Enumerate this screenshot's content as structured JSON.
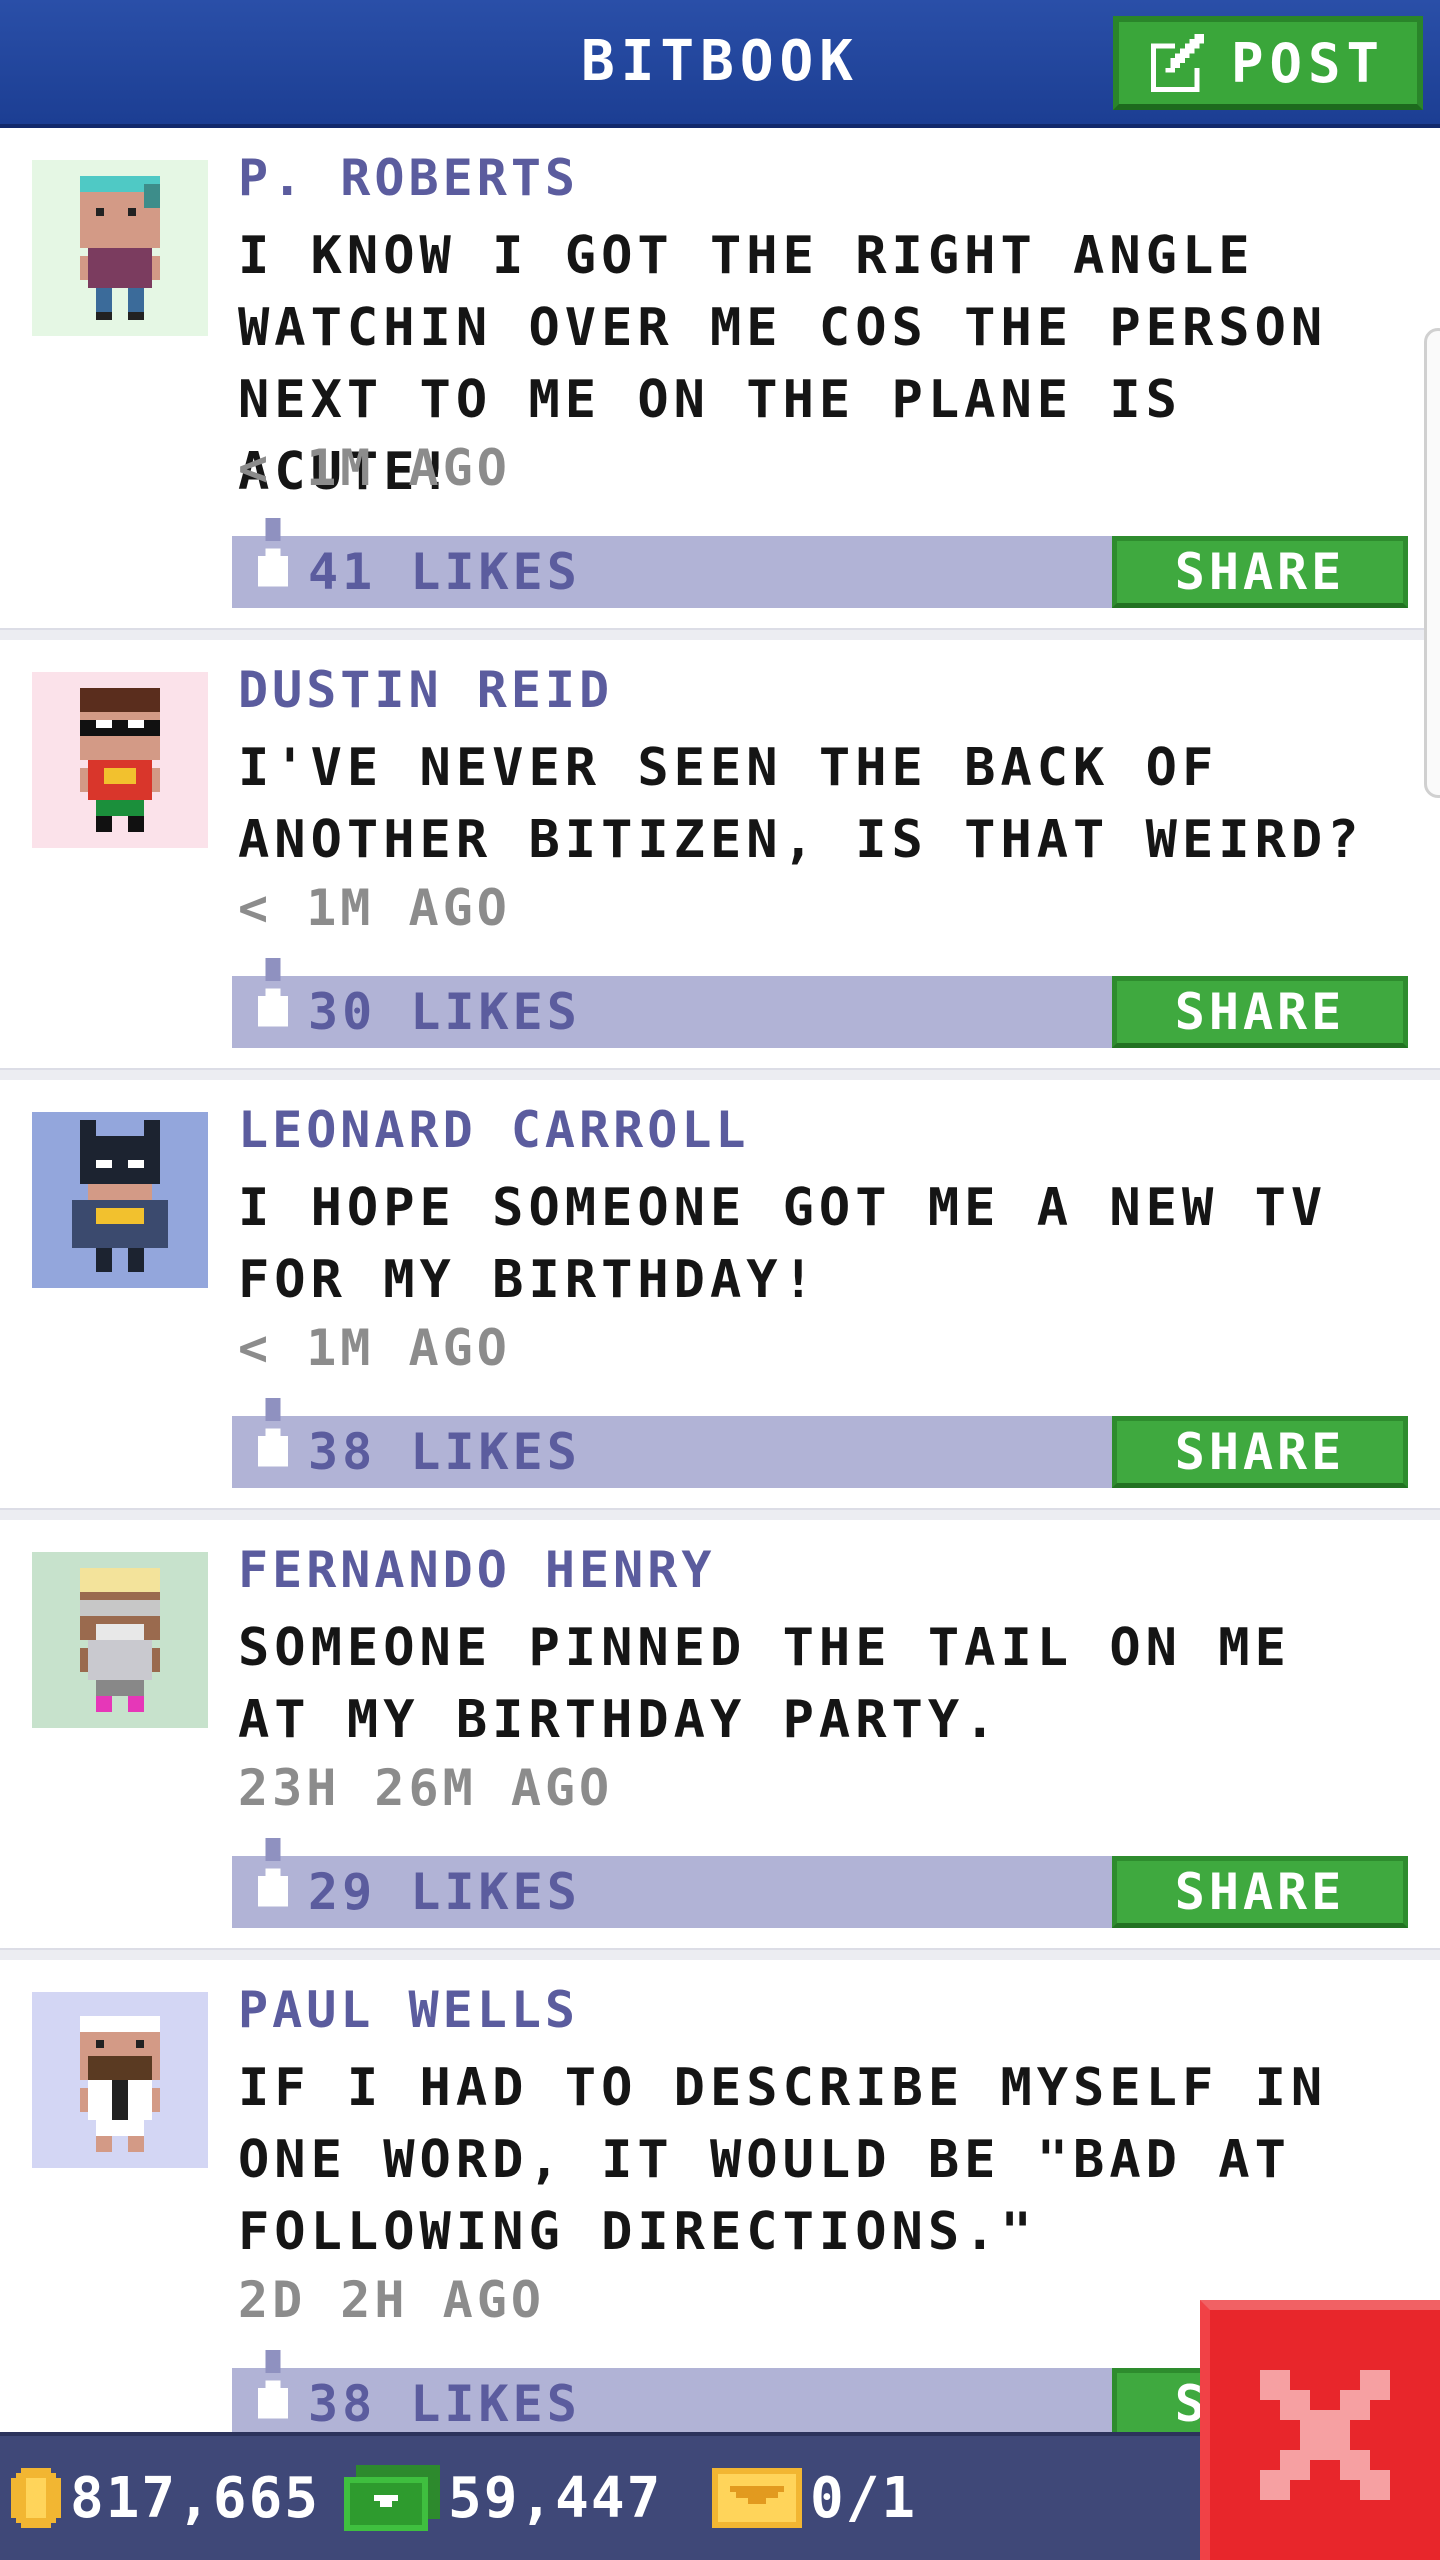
{
  "header": {
    "title": "BITBOOK",
    "post_label": "POST"
  },
  "share_label": "SHARE",
  "posts": [
    {
      "author": "P. ROBERTS",
      "message": "I KNOW I GOT THE RIGHT ANGLE WATCHIN OVER ME COS THE PERSON NEXT TO ME ON THE PLANE IS ACUTE!",
      "time": "< 1M AGO",
      "likes": "41 LIKES",
      "avatar_bg": "#e5f7e4"
    },
    {
      "author": "DUSTIN REID",
      "message": "I'VE NEVER SEEN THE BACK OF ANOTHER BITIZEN, IS THAT WEIRD?",
      "time": "< 1M AGO",
      "likes": "30 LIKES",
      "avatar_bg": "#fbe2ea"
    },
    {
      "author": "LEONARD CARROLL",
      "message": "I HOPE SOMEONE GOT ME A NEW TV FOR MY BIRTHDAY!",
      "time": "< 1M AGO",
      "likes": "38 LIKES",
      "avatar_bg": "#93a6dc"
    },
    {
      "author": "FERNANDO HENRY",
      "message": "SOMEONE PINNED THE TAIL ON ME AT MY BIRTHDAY PARTY.",
      "time": "23H 26M AGO",
      "likes": "29 LIKES",
      "avatar_bg": "#c7e2cc"
    },
    {
      "author": "PAUL WELLS",
      "message": "IF I HAD TO DESCRIBE MYSELF IN ONE WORD, IT WOULD BE \"BAD AT FOLLOWING DIRECTIONS.\"",
      "time": "2D 2H AGO",
      "likes": "38 LIKES",
      "avatar_bg": "#d3d6f4"
    }
  ],
  "status": {
    "coins": "817,665",
    "bux": "59,447",
    "tickets": "0/1"
  },
  "colors": {
    "header": "#1c3e93",
    "accent_green": "#3fa93f",
    "likes_bar": "#b1b3d6",
    "author_text": "#5b5c9e",
    "close_red": "#e8262b",
    "status_bar": "#3f4878"
  },
  "icons": [
    "edit-icon",
    "thumbs-up-icon",
    "coin-icon",
    "bux-icon",
    "ticket-icon",
    "close-icon"
  ]
}
